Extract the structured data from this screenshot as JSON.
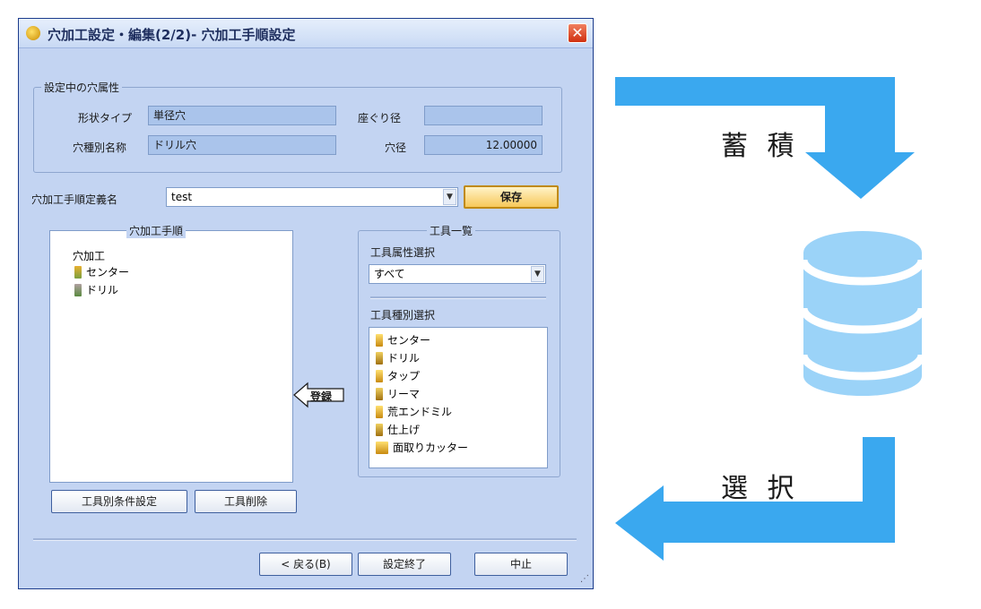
{
  "window": {
    "title": "穴加工設定・編集(2/2)- 穴加工手順設定",
    "close_glyph": "✕"
  },
  "attributes": {
    "legend": "設定中の穴属性",
    "shape_type_label": "形状タイプ",
    "shape_type_value": "単径穴",
    "counterbore_label": "座ぐり径",
    "counterbore_value": "",
    "hole_kind_label": "穴種別名称",
    "hole_kind_value": "ドリル穴",
    "diameter_label": "穴径",
    "diameter_value": "12.00000"
  },
  "procedure": {
    "name_label": "穴加工手順定義名",
    "name_value": "test",
    "save_label": "保存",
    "list_legend": "穴加工手順",
    "tree_root": "穴加工",
    "tree_items": [
      "センター",
      "ドリル"
    ],
    "register_label": "登録",
    "tool_cond_label": "工具別条件設定",
    "tool_delete_label": "工具削除"
  },
  "tools": {
    "legend": "工具一覧",
    "attr_select_label": "工具属性選択",
    "attr_select_value": "すべて",
    "kind_select_label": "工具種別選択",
    "items": [
      "センター",
      "ドリル",
      "タップ",
      "リーマ",
      "荒エンドミル",
      "仕上げ",
      "面取りカッター"
    ]
  },
  "footer": {
    "back_label": "< 戻る(B)",
    "finish_label": "設定終了",
    "cancel_label": "中止"
  },
  "diagram": {
    "store_label": "蓄 積",
    "select_label": "選 択",
    "arrow_color": "#3aa8ef",
    "db_color": "#9bd3f8"
  }
}
